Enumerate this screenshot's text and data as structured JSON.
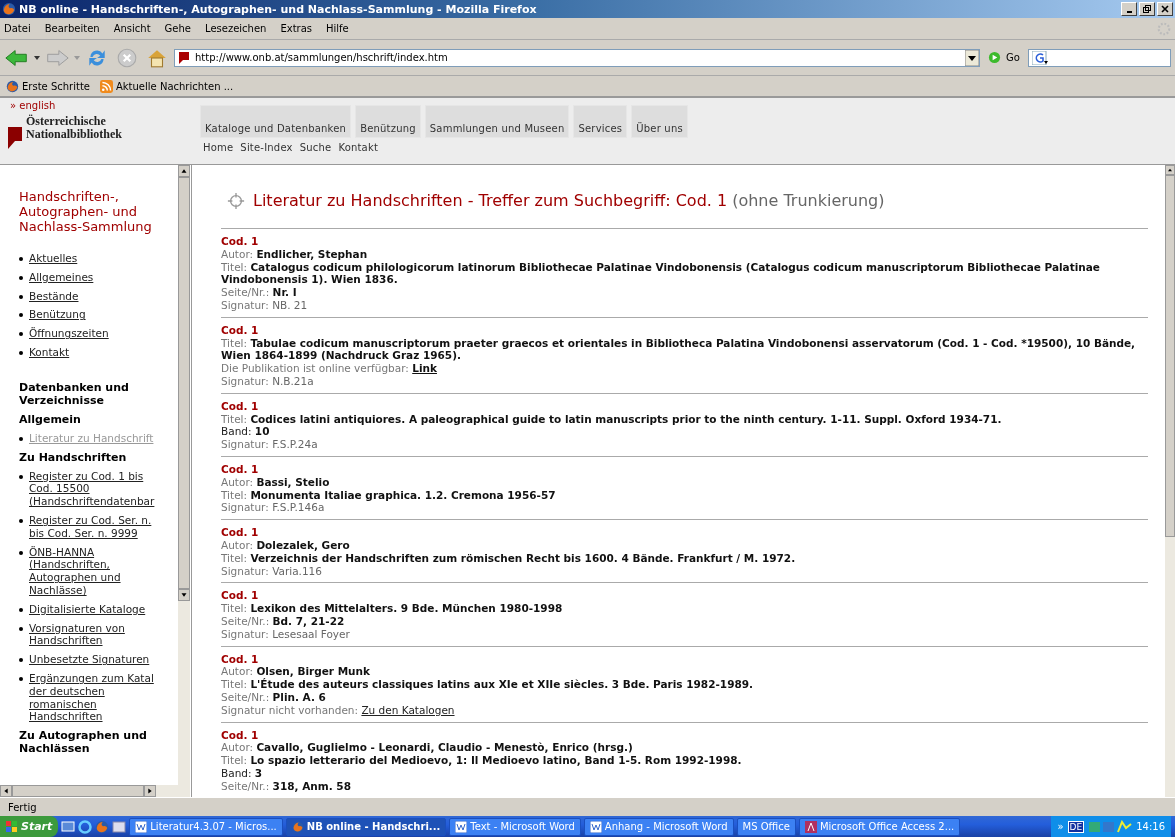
{
  "window": {
    "title": "NB online - Handschriften-, Autographen- und Nachlass-Sammlung - Mozilla Firefox"
  },
  "menu": [
    "Datei",
    "Bearbeiten",
    "Ansicht",
    "Gehe",
    "Lesezeichen",
    "Extras",
    "Hilfe"
  ],
  "address": {
    "value": "http://www.onb.at/sammlungen/hschrift/index.htm"
  },
  "go_label": "Go",
  "bookmarks": [
    {
      "label": "Erste Schritte",
      "kind": "firefox"
    },
    {
      "label": "Aktuelle Nachrichten ...",
      "kind": "feed"
    }
  ],
  "site_header": {
    "language_link": "» english",
    "logo_lines": [
      "Österreichische",
      "Nationalbibliothek"
    ],
    "nav": [
      "Kataloge und Datenbanken",
      "Benützung",
      "Sammlungen und Museen",
      "Services",
      "Über uns"
    ],
    "subnav": [
      "Home",
      "Site-Index",
      "Suche",
      "Kontakt"
    ]
  },
  "sidebar": {
    "title_lines": [
      "Handschriften-,",
      "Autographen- und",
      "Nachlass-Sammlung"
    ],
    "blocks": [
      {
        "kind": "link",
        "selected": false,
        "lines": [
          "Aktuelles"
        ]
      },
      {
        "kind": "link",
        "selected": false,
        "lines": [
          "Allgemeines"
        ]
      },
      {
        "kind": "link",
        "selected": false,
        "lines": [
          "Bestände"
        ]
      },
      {
        "kind": "link",
        "selected": false,
        "lines": [
          "Benützung"
        ]
      },
      {
        "kind": "link",
        "selected": false,
        "lines": [
          "Öffnungszeiten"
        ]
      },
      {
        "kind": "link",
        "selected": false,
        "lines": [
          "Kontakt"
        ]
      },
      {
        "kind": "heading",
        "lines": [
          "Datenbanken und",
          "Verzeichnisse"
        ]
      },
      {
        "kind": "subheading",
        "lines": [
          "Allgemein"
        ]
      },
      {
        "kind": "link",
        "selected": true,
        "lines": [
          "Literatur zu Handschrift"
        ]
      },
      {
        "kind": "subheading",
        "lines": [
          "Zu Handschriften"
        ]
      },
      {
        "kind": "link",
        "selected": false,
        "lines": [
          "Register zu Cod. 1 bis",
          "Cod. 15500",
          "(Handschriftendatenbar"
        ]
      },
      {
        "kind": "link",
        "selected": false,
        "lines": [
          "Register zu Cod. Ser. n.",
          "bis Cod. Ser. n. 9999"
        ]
      },
      {
        "kind": "link",
        "selected": false,
        "lines": [
          "ÖNB-HANNA",
          "(Handschriften,",
          "Autographen und",
          "Nachlässe)"
        ]
      },
      {
        "kind": "link",
        "selected": false,
        "lines": [
          "Digitalisierte Kataloge"
        ]
      },
      {
        "kind": "link",
        "selected": false,
        "lines": [
          "Vorsignaturen von",
          "Handschriften"
        ]
      },
      {
        "kind": "link",
        "selected": false,
        "lines": [
          "Unbesetzte Signaturen"
        ]
      },
      {
        "kind": "link",
        "selected": false,
        "lines": [
          "Ergänzungen zum Katal",
          "der deutschen",
          "romanischen",
          "Handschriften"
        ]
      },
      {
        "kind": "subheading",
        "lines": [
          "Zu Autographen und",
          "Nachlässen"
        ]
      }
    ]
  },
  "results": {
    "title": "Literatur zu Handschriften - Treffer zum Suchbegriff: Cod. 1",
    "title_note": "(ohne Trunkierung)",
    "entries": [
      {
        "code": "Cod. 1",
        "fields": [
          {
            "kind": "bold",
            "label": "Autor:",
            "value": "Endlicher, Stephan"
          },
          {
            "kind": "bold",
            "label": "Titel:",
            "value": "Catalogus codicum philologicorum latinorum Bibliothecae Palatinae Vindobonensis (Catalogus codicum manuscriptorum Bibliothecae Palatinae Vindobonensis 1). Wien 1836."
          },
          {
            "kind": "bold",
            "label": "Seite/Nr.:",
            "value": "Nr. I"
          },
          {
            "kind": "muted",
            "label": "Signatur:",
            "value": "NB. 21"
          }
        ]
      },
      {
        "code": "Cod. 1",
        "fields": [
          {
            "kind": "bold",
            "label": "Titel:",
            "value": "Tabulae codicum manuscriptorum praeter graecos et orientales in Bibliotheca Palatina Vindobonensi asservatorum (Cod. 1 - Cod. *19500), 10 Bände, Wien 1864-1899 (Nachdruck Graz 1965)."
          },
          {
            "kind": "boldlink",
            "label": "Die Publikation ist online verfügbar:",
            "value": "Link"
          },
          {
            "kind": "muted",
            "label": "Signatur:",
            "value": "N.B.21a"
          }
        ]
      },
      {
        "code": "Cod. 1",
        "fields": [
          {
            "kind": "bold",
            "label": "Titel:",
            "value": "Codices latini antiquiores. A paleographical guide to latin manuscripts prior to the ninth century. 1-11. Suppl. Oxford 1934-71."
          },
          {
            "kind": "count",
            "label": "Band:",
            "value": "10"
          },
          {
            "kind": "muted",
            "label": "Signatur:",
            "value": "F.S.P.24a"
          }
        ]
      },
      {
        "code": "Cod. 1",
        "fields": [
          {
            "kind": "bold",
            "label": "Autor:",
            "value": "Bassi, Stelio"
          },
          {
            "kind": "bold",
            "label": "Titel:",
            "value": "Monumenta Italiae graphica. 1.2. Cremona 1956-57"
          },
          {
            "kind": "muted",
            "label": "Signatur:",
            "value": "F.S.P.146a"
          }
        ]
      },
      {
        "code": "Cod. 1",
        "fields": [
          {
            "kind": "bold",
            "label": "Autor:",
            "value": "Dolezalek, Gero"
          },
          {
            "kind": "bold",
            "label": "Titel:",
            "value": "Verzeichnis der Handschriften zum römischen Recht bis 1600. 4 Bände. Frankfurt / M. 1972."
          },
          {
            "kind": "muted",
            "label": "Signatur:",
            "value": "Varia.116"
          }
        ]
      },
      {
        "code": "Cod. 1",
        "fields": [
          {
            "kind": "bold",
            "label": "Titel:",
            "value": "Lexikon des Mittelalters. 9 Bde. München 1980-1998"
          },
          {
            "kind": "bold",
            "label": "Seite/Nr.:",
            "value": "Bd. 7, 21-22"
          },
          {
            "kind": "muted",
            "label": "Signatur:",
            "value": "Lesesaal Foyer"
          }
        ]
      },
      {
        "code": "Cod. 1",
        "fields": [
          {
            "kind": "bold",
            "label": "Autor:",
            "value": "Olsen, Birger Munk"
          },
          {
            "kind": "bold",
            "label": "Titel:",
            "value": "L'Étude des auteurs classiques latins aux XIe et XIIe siècles. 3 Bde. Paris 1982-1989."
          },
          {
            "kind": "bold",
            "label": "Seite/Nr.:",
            "value": "Plin. A. 6"
          },
          {
            "kind": "link",
            "label": "Signatur nicht vorhanden:",
            "value": "Zu den Katalogen"
          }
        ]
      },
      {
        "code": "Cod. 1",
        "fields": [
          {
            "kind": "bold",
            "label": "Autor:",
            "value": "Cavallo, Guglielmo - Leonardi, Claudio - Menestò, Enrico (hrsg.)"
          },
          {
            "kind": "bold",
            "label": "Titel:",
            "value": "Lo spazio letterario del Medioevo, 1: Il Medioevo latino, Band 1-5. Rom 1992-1998."
          },
          {
            "kind": "count",
            "label": "Band:",
            "value": "3"
          },
          {
            "kind": "bold",
            "label": "Seite/Nr.:",
            "value": "318, Anm. 58"
          }
        ]
      }
    ]
  },
  "status_bar": "Fertig",
  "taskbar": {
    "start": "Start",
    "items": [
      {
        "label": "Literatur4.3.07 - Micros...",
        "kind": "word",
        "selected": false
      },
      {
        "label": "NB online - Handschri...",
        "kind": "firefox",
        "selected": true
      },
      {
        "label": "Text - Microsoft Word",
        "kind": "word",
        "selected": false
      },
      {
        "label": "Anhang - Microsoft Word",
        "kind": "word",
        "selected": false
      },
      {
        "label": "MS Office",
        "kind": "none",
        "selected": false
      },
      {
        "label": "Microsoft Office Access 2...",
        "kind": "access",
        "selected": false
      }
    ],
    "chevron": "»",
    "language": "DE",
    "clock": "14:16"
  }
}
